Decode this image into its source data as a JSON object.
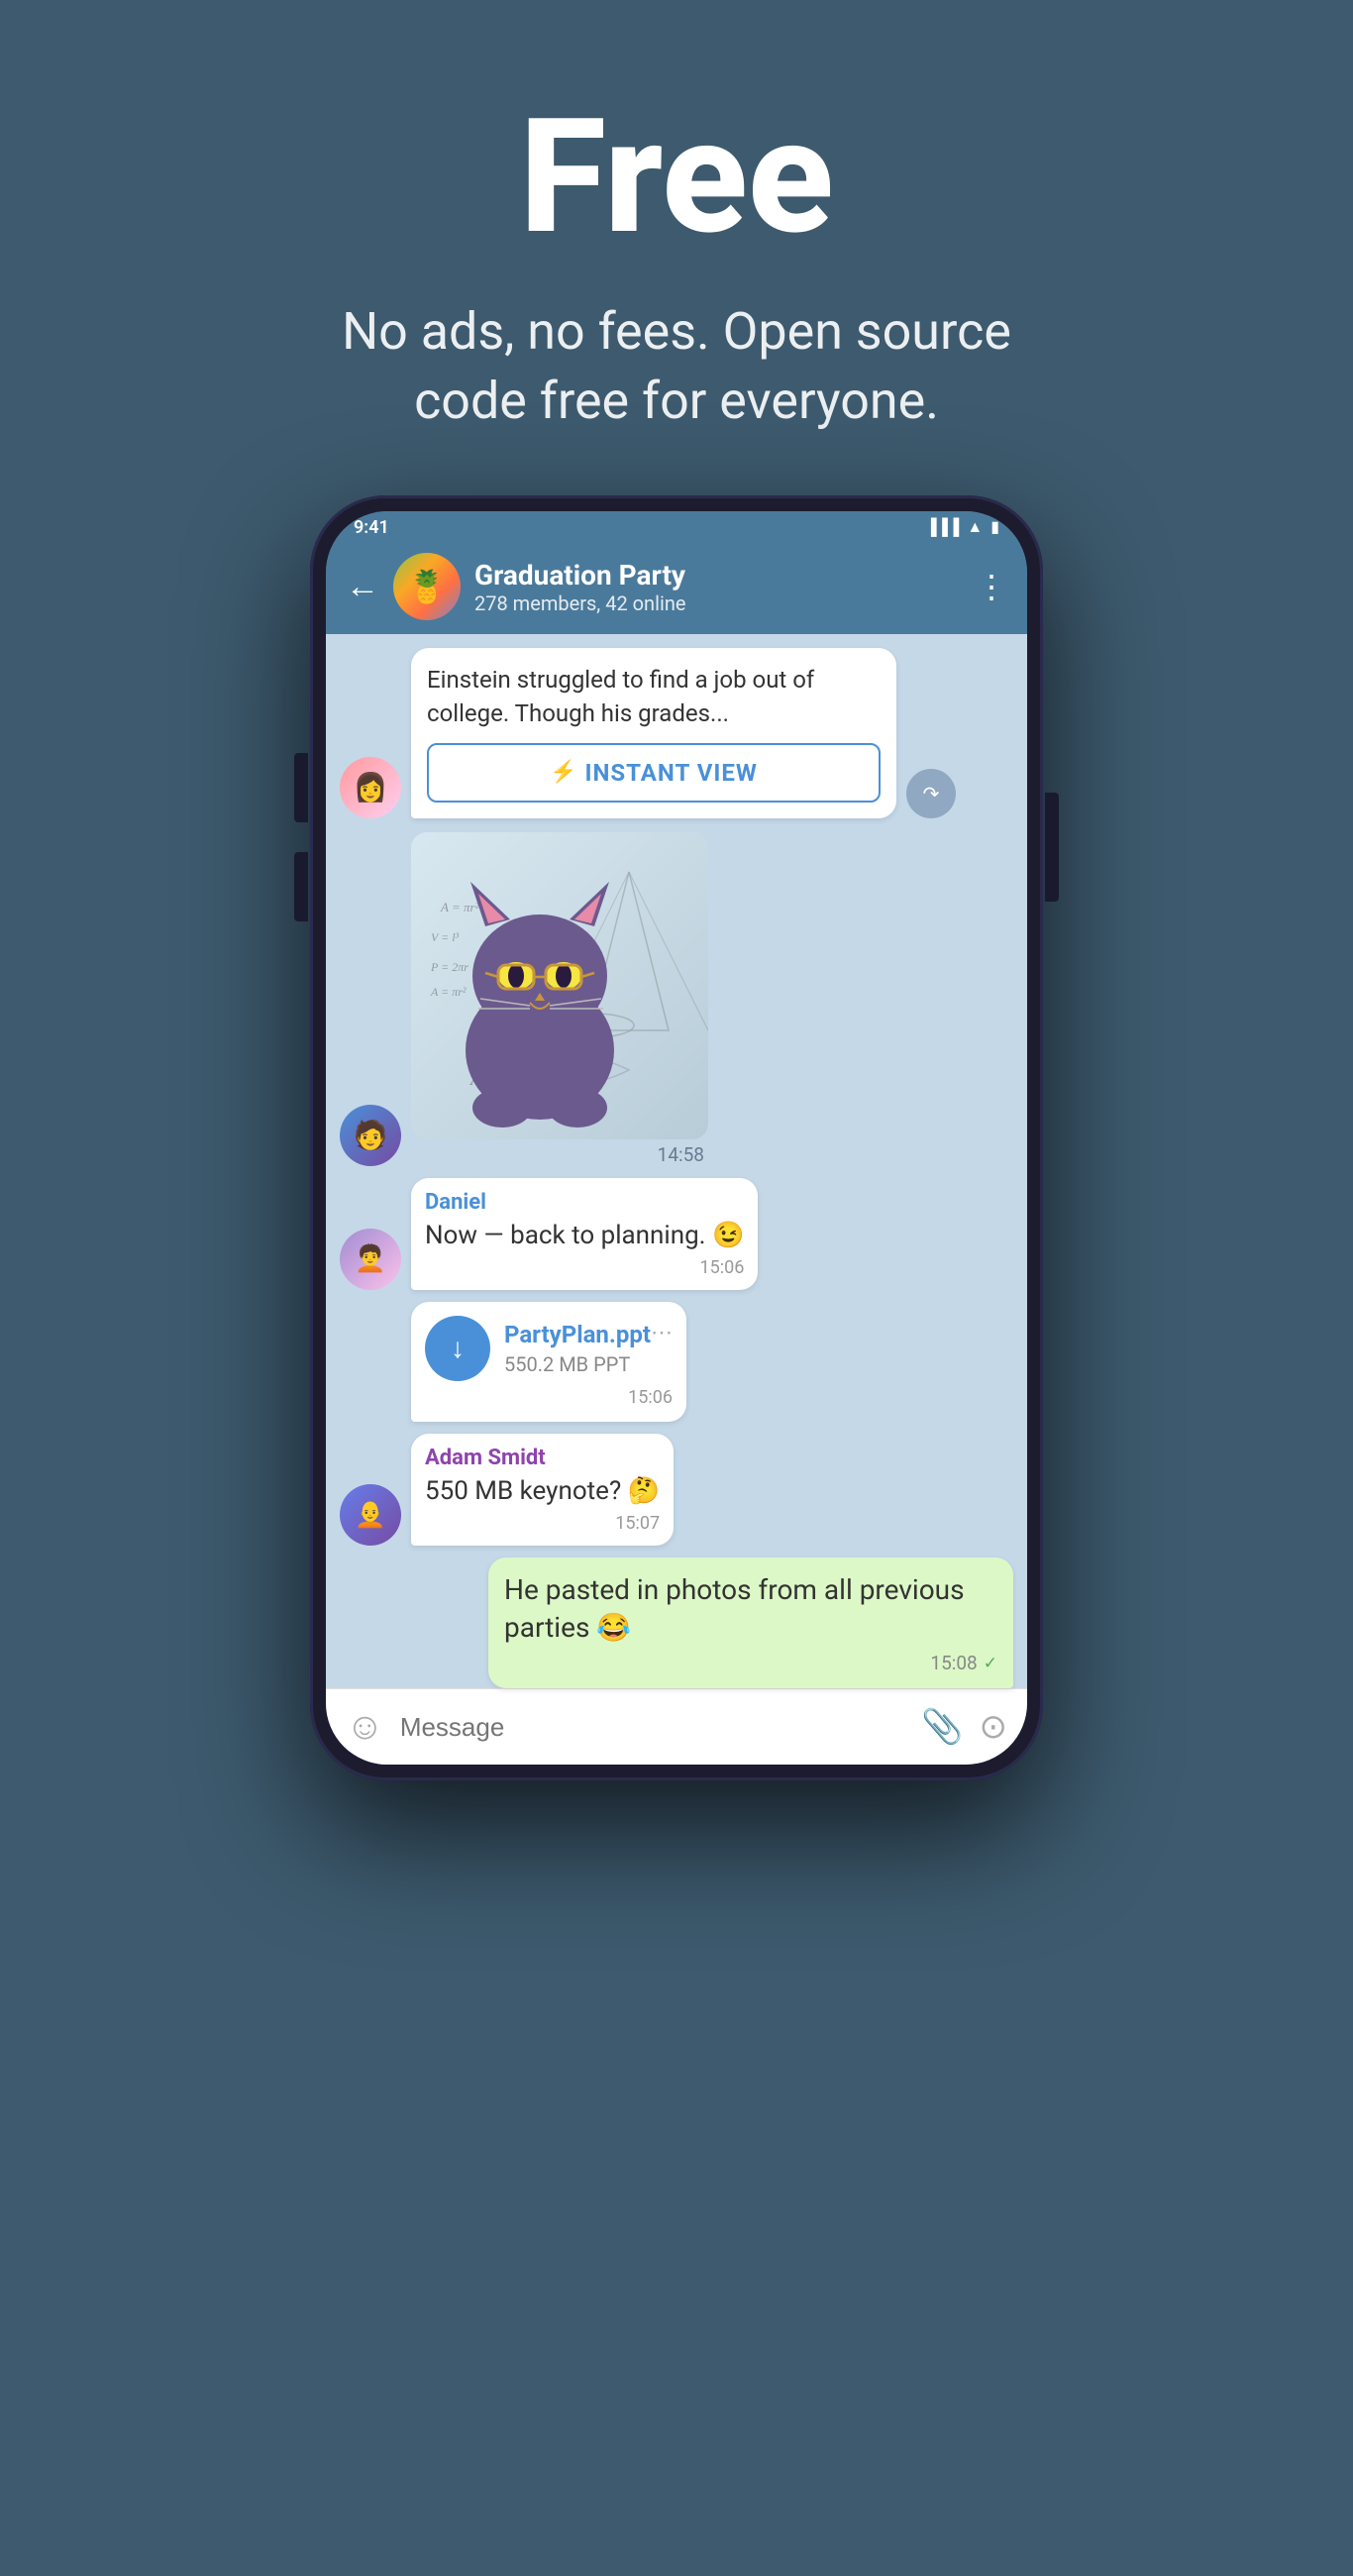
{
  "header": {
    "main_title": "Free",
    "subtitle": "No ads, no fees. Open source code free for everyone."
  },
  "chat": {
    "group_name": "Graduation Party",
    "group_members": "278 members, 42 online",
    "back_label": "←",
    "more_label": "⋮",
    "article_preview": {
      "text": "Einstein struggled to find a job out of college. Though his grades...",
      "instant_view_label": "INSTANT VIEW"
    },
    "sticker_time": "14:58",
    "messages": [
      {
        "id": "msg1",
        "sender": "Daniel",
        "text": "Now — back to planning. 😉",
        "time": "15:06",
        "own": false
      },
      {
        "id": "msg2",
        "file_name": "PartyPlan.ppt",
        "file_size": "550.2 MB PPT",
        "time": "15:06",
        "own": false
      },
      {
        "id": "msg3",
        "sender": "Adam Smidt",
        "text": "550 MB keynote? 🤔",
        "time": "15:07",
        "own": false
      },
      {
        "id": "msg4",
        "text": "He pasted in photos from all previous parties 😂",
        "time": "15:08",
        "own": true,
        "check": "✓"
      }
    ],
    "input_placeholder": "Message"
  }
}
